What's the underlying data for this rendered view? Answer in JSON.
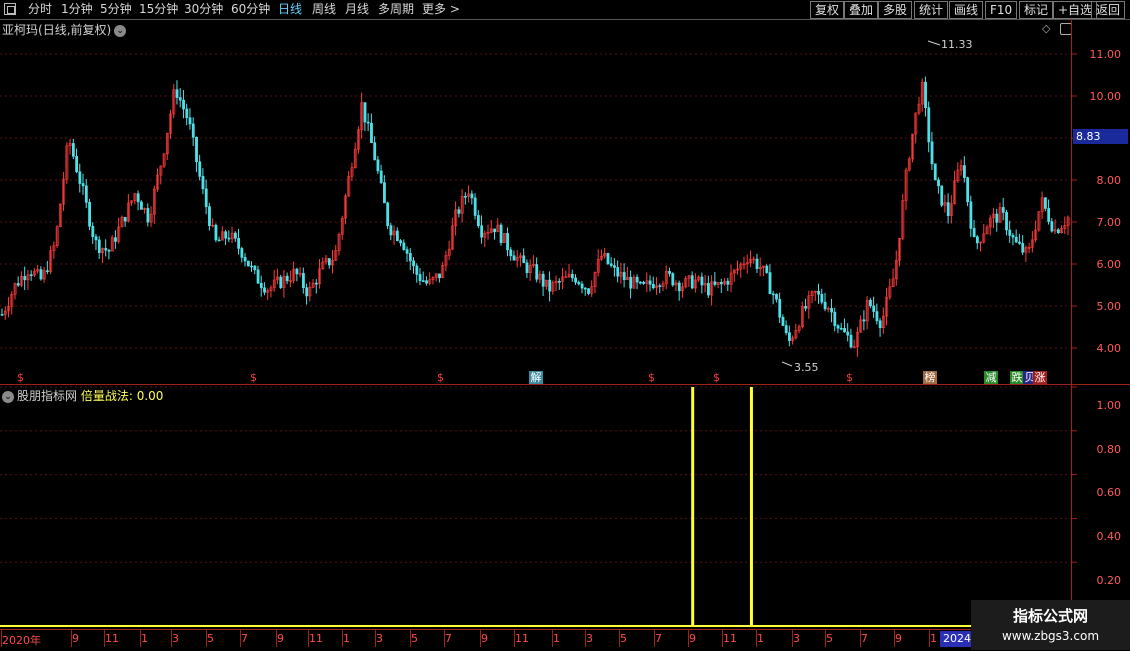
{
  "toolbar": {
    "periods": [
      "分时",
      "1分钟",
      "5分钟",
      "15分钟",
      "30分钟",
      "60分钟",
      "日线",
      "周线",
      "月线",
      "多周期",
      "更多 >"
    ],
    "active_period": "日线",
    "buttons": [
      "复权",
      "叠加",
      "多股",
      "统计",
      "画线",
      "F10",
      "标记",
      "+自选",
      "返回"
    ]
  },
  "main_panel": {
    "stock_name": "亚柯玛",
    "mode": "(日线,前复权)",
    "current_price": "8.83",
    "high_label": "11.33",
    "low_label": "3.55",
    "y_ticks": [
      "11.00",
      "10.00",
      "9.00",
      "8.00",
      "7.00",
      "6.00",
      "5.00",
      "4.00"
    ],
    "signals": [
      {
        "text": "解",
        "color": "#5ab0c8"
      },
      {
        "text": "榜",
        "color": "#c89060"
      },
      {
        "text": "减",
        "color": "#2a9a2a"
      },
      {
        "text": "跌",
        "color": "#2a9a2a"
      },
      {
        "text": "贝",
        "color": "#2a2a9a"
      },
      {
        "text": "涨",
        "color": "#b02020"
      }
    ],
    "dollar_marker": "$"
  },
  "sub_panel": {
    "source": "股朋指标网",
    "indicator_name": "倍量战法:",
    "indicator_value": "0.00",
    "y_ticks": [
      "1.00",
      "0.80",
      "0.60",
      "0.40",
      "0.20"
    ]
  },
  "date_axis": {
    "labels": [
      "2020年",
      "9",
      "11",
      "1",
      "3",
      "5",
      "7",
      "9",
      "11",
      "1",
      "3",
      "5",
      "7",
      "9",
      "11",
      "1",
      "3",
      "5",
      "7",
      "9",
      "11",
      "1",
      "3",
      "5",
      "7",
      "9",
      "1"
    ],
    "end_label": "2024/"
  },
  "watermark": {
    "title": "指标公式网",
    "url": "www.zbgs3.com"
  },
  "chart_data": [
    {
      "type": "candlestick",
      "title": "亚柯玛(日线,前复权)",
      "ylim": [
        3.5,
        11.5
      ],
      "yticks": [
        4,
        5,
        6,
        7,
        8,
        9,
        10,
        11
      ],
      "series": [
        {
          "values": [
            4.8,
            5.5,
            5.9,
            5.6,
            6.5,
            9.0,
            7.8,
            6.5,
            6.3,
            7.0,
            7.7,
            7.1,
            8.5,
            10.2,
            9.4,
            7.8,
            6.5,
            6.7,
            6.3,
            5.7,
            5.4,
            5.6,
            5.8,
            5.3,
            5.9,
            6.2,
            8.0,
            9.8,
            8.5,
            6.9,
            6.6,
            5.8,
            5.5,
            5.8,
            7.1,
            7.8,
            6.8,
            6.9,
            6.4,
            6.0,
            5.8,
            5.4,
            5.6,
            5.7,
            5.4,
            6.2,
            5.8,
            5.6,
            5.4,
            5.6,
            5.7,
            5.5,
            5.6,
            5.4,
            5.5,
            5.8,
            6.2,
            5.9,
            5.2,
            4.1,
            4.8,
            5.3,
            5.0,
            4.4,
            4.1,
            5.1,
            4.6,
            5.8,
            8.5,
            10.3,
            7.9,
            7.2,
            8.5,
            6.4,
            7.0,
            7.2,
            6.5,
            6.2,
            7.5,
            6.8,
            7.1
          ]
        }
      ],
      "annotations": [
        {
          "text": "11.33",
          "kind": "high"
        },
        {
          "text": "3.55",
          "kind": "low"
        },
        {
          "text": "8.83",
          "kind": "current"
        }
      ]
    },
    {
      "type": "bar",
      "title": "倍量战法",
      "ylim": [
        0,
        1.05
      ],
      "yticks": [
        0.2,
        0.4,
        0.6,
        0.8,
        1.0
      ],
      "series": [
        {
          "name": "倍量战法",
          "values": [
            1,
            1
          ],
          "positions": [
            0.613,
            0.665
          ]
        }
      ],
      "baseline": 0
    }
  ],
  "colors": {
    "up": "#ff3b3b",
    "down": "#4fe0e8",
    "axis": "#a0201a",
    "bar": "#ffff33",
    "grid": "#5a1010"
  }
}
